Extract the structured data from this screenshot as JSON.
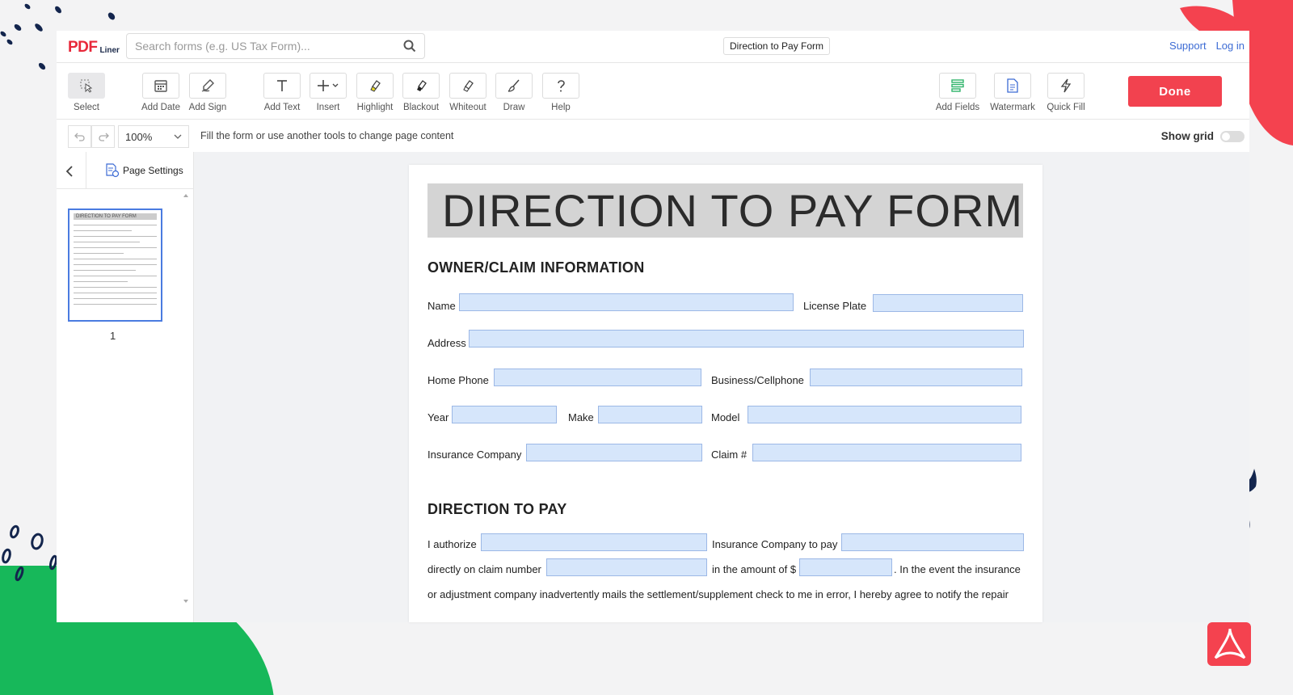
{
  "app": {
    "logo": {
      "main": "PDF",
      "sub": "Liner"
    },
    "search": {
      "placeholder": "Search forms (e.g. US Tax Form)..."
    },
    "document_title": "Direction to Pay Form",
    "links": {
      "support": "Support",
      "login": "Log in"
    }
  },
  "toolbar": {
    "tools": [
      {
        "id": "select",
        "label": "Select",
        "icon": "cursor-select-icon"
      },
      {
        "id": "add-date",
        "label": "Add Date",
        "icon": "calendar-icon"
      },
      {
        "id": "add-sign",
        "label": "Add Sign",
        "icon": "pen-sign-icon"
      },
      {
        "id": "add-text",
        "label": "Add Text",
        "icon": "text-t-icon"
      },
      {
        "id": "insert",
        "label": "Insert",
        "icon": "plus-icon"
      },
      {
        "id": "highlight",
        "label": "Highlight",
        "icon": "highlighter-icon"
      },
      {
        "id": "blackout",
        "label": "Blackout",
        "icon": "marker-icon"
      },
      {
        "id": "whiteout",
        "label": "Whiteout",
        "icon": "eraser-icon"
      },
      {
        "id": "draw",
        "label": "Draw",
        "icon": "brush-icon"
      },
      {
        "id": "help",
        "label": "Help",
        "icon": "question-icon"
      },
      {
        "id": "add-fields",
        "label": "Add Fields",
        "icon": "fields-icon"
      },
      {
        "id": "watermark",
        "label": "Watermark",
        "icon": "watermark-icon"
      },
      {
        "id": "quick-fill",
        "label": "Quick Fill",
        "icon": "lightning-icon"
      }
    ],
    "done_label": "Done",
    "accent": "#f2424f"
  },
  "subbar": {
    "zoom": "100%",
    "hint": "Fill the form or use another tools to change page content",
    "show_grid_label": "Show grid"
  },
  "sidebar": {
    "page_settings_label": "Page Settings",
    "thumb_title": "DIRECTION TO PAY FORM",
    "page_number": "1"
  },
  "document": {
    "heading": "DIRECTION TO PAY FORM",
    "section1": "OWNER/CLAIM INFORMATION",
    "section2": "DIRECTION TO PAY",
    "labels": {
      "name": "Name",
      "license_plate": "License Plate",
      "address": "Address",
      "home_phone": "Home Phone",
      "business_cellphone": "Business/Cellphone",
      "year": "Year",
      "make": "Make",
      "model": "Model",
      "insurance_company": "Insurance Company",
      "claim": "Claim #",
      "i_authorize": "I authorize",
      "insurance_company_to_pay": "Insurance Company to pay",
      "directly_on_claim": "directly on claim number",
      "in_the_amount": "in the amount of $",
      "in_the_event": ". In the event the insurance",
      "paragraph_line": "or adjustment company inadvertently mails the settlement/supplement check to me in error, I hereby agree to notify the repair"
    },
    "field_color": "#d6e6fb"
  }
}
